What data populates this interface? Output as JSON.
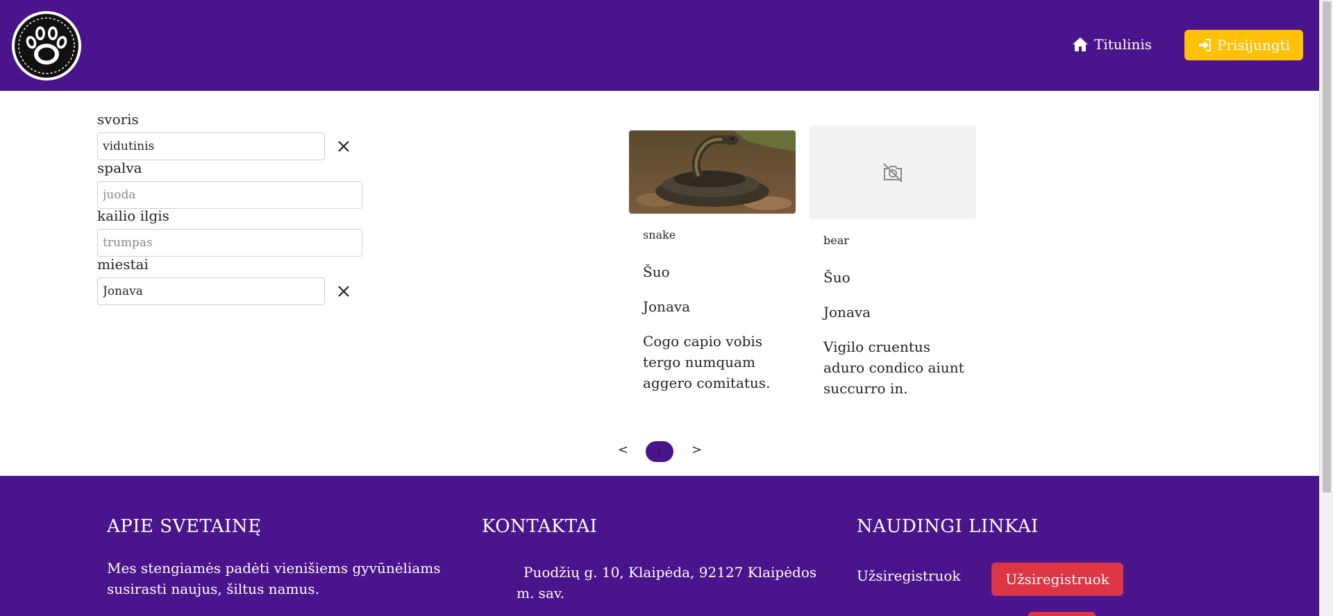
{
  "header": {
    "logo_icon": "paw-logo",
    "nav_home": "Titulinis",
    "nav_login": "Prisijungti",
    "brand_color": "#4a148c",
    "login_color": "#ffc107"
  },
  "filters": [
    {
      "label": "svoris",
      "value": "vidutinis",
      "placeholder": "",
      "clearable": true
    },
    {
      "label": "spalva",
      "value": "",
      "placeholder": "juoda",
      "clearable": false
    },
    {
      "label": "kailio ilgis",
      "value": "",
      "placeholder": "trumpas",
      "clearable": false
    },
    {
      "label": "miestai",
      "value": "Jonava",
      "placeholder": "",
      "clearable": true
    }
  ],
  "cards": [
    {
      "name": "snake",
      "type": "Šuo",
      "city": "Jonava",
      "description": "Cogo capio vobis tergo numquam aggero comitatus.",
      "image": "snake-photo"
    },
    {
      "name": "bear",
      "type": "Šuo",
      "city": "Jonava",
      "description": "Vigilo cruentus aduro condico aiunt succurro in.",
      "image": "no-image-icon"
    }
  ],
  "pagination": {
    "prev": "<",
    "current": "1",
    "next": ">"
  },
  "footer": {
    "about": {
      "title": "APIE SVETAINĘ",
      "text": "Mes stengiamės padėti vienišiems gyvūnėliams susirasti naujus, šiltus namus."
    },
    "contacts": {
      "title": "KONTAKTAI",
      "address": "Puodžių g. 10, Klaipėda, 92127 Klaipėdos m. sav."
    },
    "links": {
      "title": "NAUDINGI LINKAI",
      "register_label": "Užsiregistruok",
      "register_button": "Užsiregistruok"
    },
    "button_color": "#dc3545"
  }
}
